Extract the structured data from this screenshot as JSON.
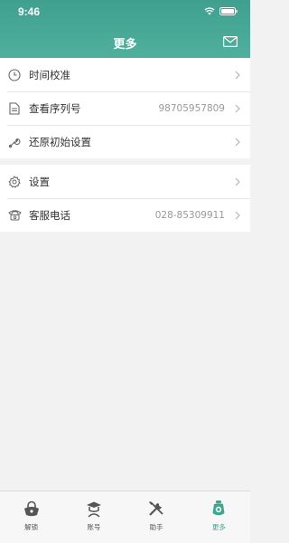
{
  "status_bar": {
    "time": "9:46"
  },
  "header": {
    "title": "更多"
  },
  "group1": [
    {
      "label": "时间校准",
      "value": ""
    },
    {
      "label": "查看序列号",
      "value": "98705957809"
    },
    {
      "label": "还原初始设置",
      "value": ""
    }
  ],
  "group2": [
    {
      "label": "设置",
      "value": ""
    },
    {
      "label": "客服电话",
      "value": "028-85309911"
    }
  ],
  "tabs": [
    {
      "label": "解锁",
      "icon": "unlock-icon",
      "active": false
    },
    {
      "label": "账号",
      "icon": "account-icon",
      "active": false
    },
    {
      "label": "助手",
      "icon": "assistant-icon",
      "active": false
    },
    {
      "label": "更多",
      "icon": "more-icon",
      "active": true
    }
  ],
  "colors": {
    "header": "#46a895",
    "accent": "#3aa88f",
    "background": "#f2f2f2"
  }
}
